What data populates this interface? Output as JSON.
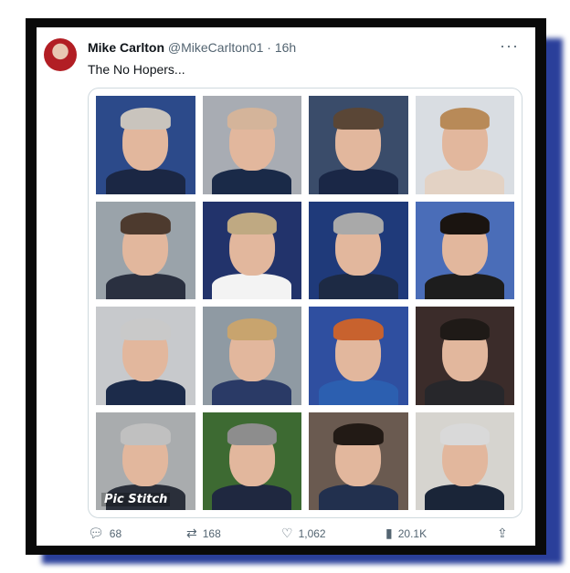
{
  "tweet": {
    "author_name": "Mike Carlton",
    "author_handle": "@MikeCarlton01",
    "time": "16h",
    "text": "The No Hopers...",
    "more_icon": "ellipsis-icon"
  },
  "media": {
    "watermark": "Pic Stitch",
    "photos": [
      {
        "bg": "#2c4a8a",
        "hair": "#c9c4bd",
        "suit": "#1b2744"
      },
      {
        "bg": "#a8acb3",
        "hair": "#d4b49a",
        "suit": "#1a2a48"
      },
      {
        "bg": "#3a4c6a",
        "hair": "#5a4636",
        "suit": "#1a2746"
      },
      {
        "bg": "#d9dde2",
        "hair": "#b88a58",
        "suit": "#e3d2c4"
      },
      {
        "bg": "#9aa3aa",
        "hair": "#4d3a2e",
        "suit": "#2a3040"
      },
      {
        "bg": "#22336b",
        "hair": "#bfa982",
        "suit": "#f3f3f3"
      },
      {
        "bg": "#1f3a7a",
        "hair": "#a9a9a9",
        "suit": "#1d2a44"
      },
      {
        "bg": "#4a6db8",
        "hair": "#1a1410",
        "suit": "#1d1d1d"
      },
      {
        "bg": "#c7c9cc",
        "hair": "#c9c9c9",
        "suit": "#1c2b4a"
      },
      {
        "bg": "#8f9aa3",
        "hair": "#c8a46e",
        "suit": "#2a3a66"
      },
      {
        "bg": "#2f4fa0",
        "hair": "#c8622e",
        "suit": "#2c5fb0"
      },
      {
        "bg": "#3b2c2a",
        "hair": "#1f1a17",
        "suit": "#27272b"
      },
      {
        "bg": "#a9acae",
        "hair": "#c0c0c0",
        "suit": "#2a2f3a"
      },
      {
        "bg": "#3d6a32",
        "hair": "#8d8d8d",
        "suit": "#1f2840"
      },
      {
        "bg": "#6a5a50",
        "hair": "#221a15",
        "suit": "#22304e"
      },
      {
        "bg": "#d6d4cf",
        "hair": "#d9d9d9",
        "suit": "#1a2538"
      }
    ]
  },
  "actions": {
    "replies": "68",
    "reposts": "168",
    "likes": "1,062",
    "views": "20.1K",
    "reply_icon": "reply-icon",
    "repost_icon": "repost-icon",
    "like_icon": "like-icon",
    "views_icon": "views-icon",
    "share_icon": "share-icon"
  }
}
